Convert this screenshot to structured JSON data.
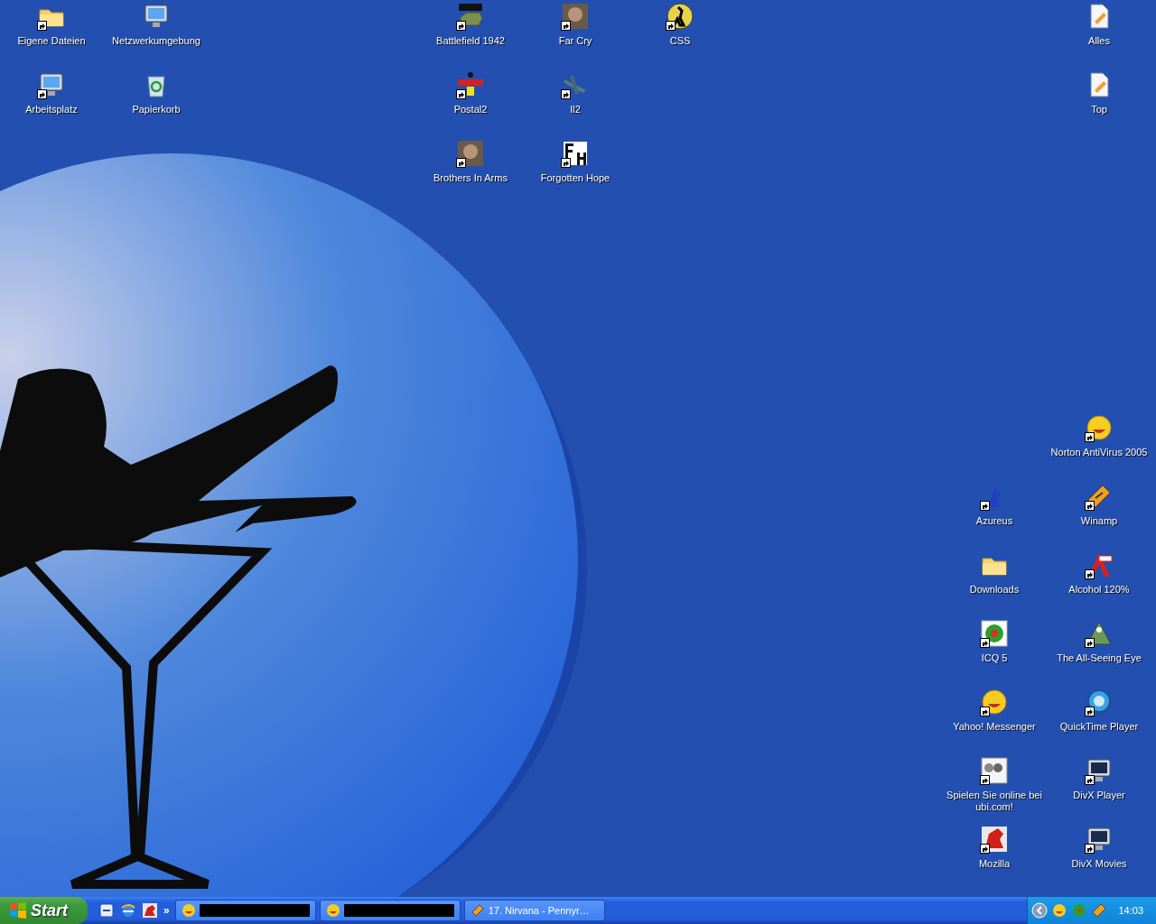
{
  "desktop_icons": [
    {
      "label": "Eigene Dateien",
      "shortcut": true
    },
    {
      "label": "Netzwerkumgebung",
      "shortcut": false
    },
    {
      "label": "Battlefield 1942",
      "shortcut": true
    },
    {
      "label": "Far Cry",
      "shortcut": true
    },
    {
      "label": "CSS",
      "shortcut": true
    },
    {
      "label": "Alles",
      "shortcut": false
    },
    {
      "label": "Arbeitsplatz",
      "shortcut": true
    },
    {
      "label": "Papierkorb",
      "shortcut": false
    },
    {
      "label": "Postal2",
      "shortcut": true
    },
    {
      "label": "Il2",
      "shortcut": true
    },
    {
      "label": "Top",
      "shortcut": false
    },
    {
      "label": "Brothers In Arms",
      "shortcut": true
    },
    {
      "label": "Forgotten Hope",
      "shortcut": true
    },
    {
      "label": "Norton AntiVirus 2005",
      "shortcut": true
    },
    {
      "label": "Azureus",
      "shortcut": true
    },
    {
      "label": "Winamp",
      "shortcut": true
    },
    {
      "label": "Downloads",
      "shortcut": false
    },
    {
      "label": "Alcohol 120%",
      "shortcut": true
    },
    {
      "label": "ICQ 5",
      "shortcut": true
    },
    {
      "label": "The All-Seeing Eye",
      "shortcut": true
    },
    {
      "label": "Yahoo! Messenger",
      "shortcut": true
    },
    {
      "label": "QuickTime Player",
      "shortcut": true
    },
    {
      "label": "Spielen Sie online bei ubi.com!",
      "shortcut": true
    },
    {
      "label": "DivX Player",
      "shortcut": true
    },
    {
      "label": "Mozilla",
      "shortcut": true
    },
    {
      "label": "DivX Movies",
      "shortcut": true
    }
  ],
  "taskbar": {
    "start_label": "Start",
    "more_label": "»",
    "tasks": [
      {
        "kind": "redacted"
      },
      {
        "kind": "redacted"
      },
      {
        "kind": "titled",
        "title": "17. Nirvana - Pennyr…"
      }
    ],
    "clock": "14:03"
  }
}
